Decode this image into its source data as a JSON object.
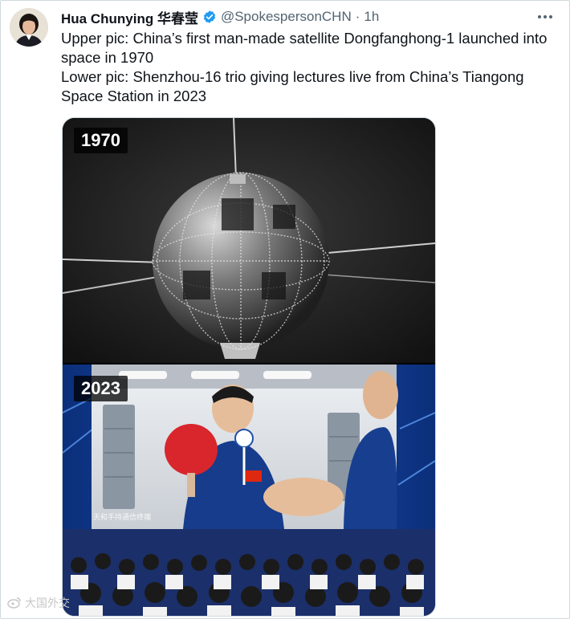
{
  "tweet": {
    "author_name": "Hua Chunying 华春莹",
    "handle": "@SpokespersonCHN",
    "separator": "·",
    "time": "1h",
    "text_line1": "Upper pic: China’s first man-made satellite Dongfanghong-1 launched into space in 1970",
    "text_line2": "Lower pic: Shenzhou-16 trio giving lectures live from China’s Tiangong Space Station in 2023"
  },
  "media": {
    "top_year": "1970",
    "bottom_year": "2023",
    "caption_overlay": "天和手持通信终端"
  },
  "watermark": {
    "text": "大国外交"
  },
  "colors": {
    "verified": "#1d9bf0",
    "text": "#0f1419",
    "muted": "#536471",
    "border": "#cfd9de"
  },
  "icons": {
    "verified": "verified-badge-icon",
    "more": "more-options-icon",
    "watermark": "weibo-icon"
  }
}
